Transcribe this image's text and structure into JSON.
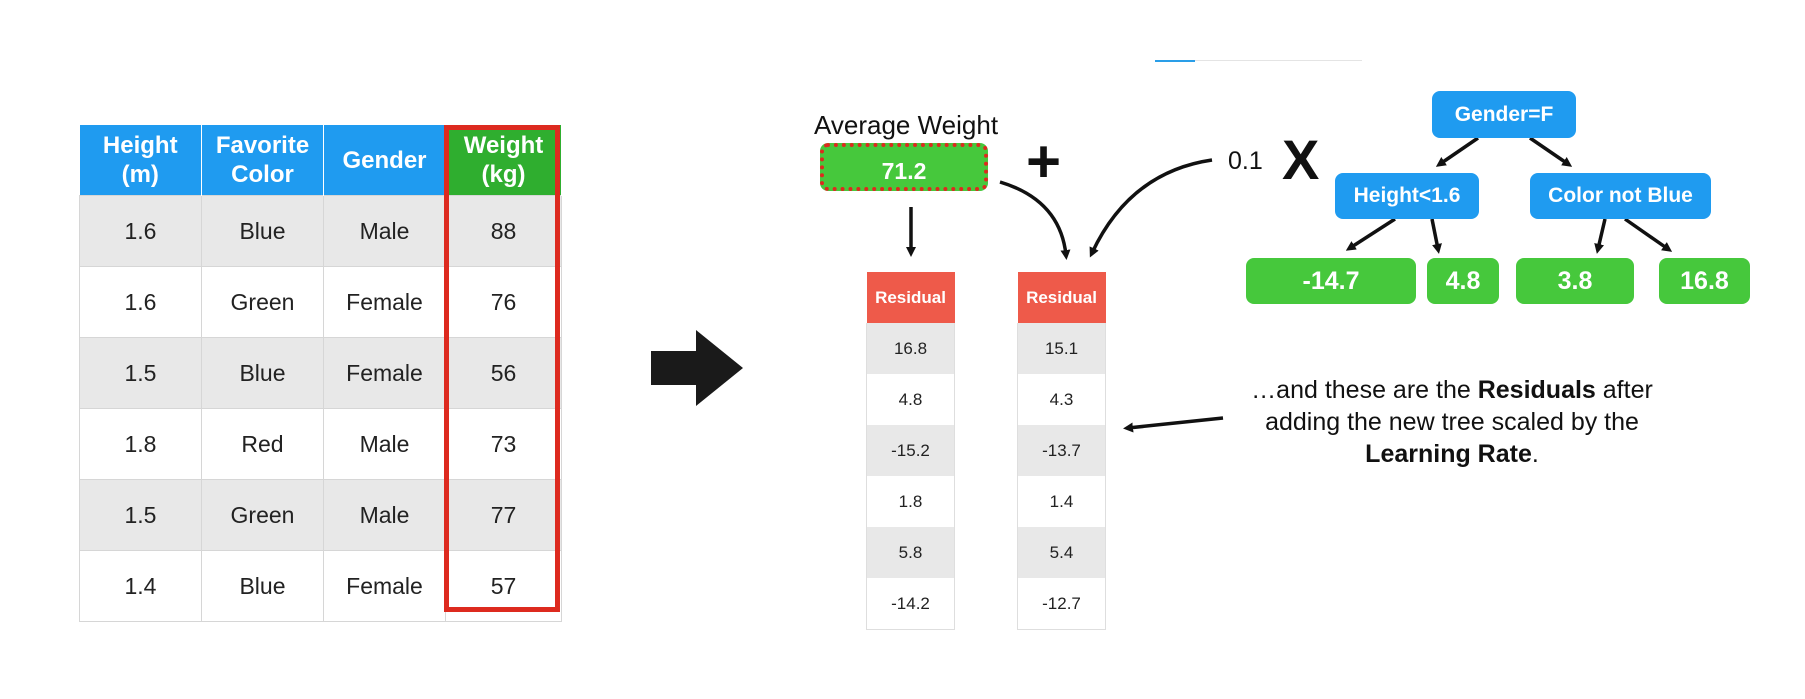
{
  "table": {
    "headers": [
      "Height\n(m)",
      "Favorite\nColor",
      "Gender",
      "Weight\n(kg)"
    ],
    "rows": [
      [
        "1.6",
        "Blue",
        "Male",
        "88"
      ],
      [
        "1.6",
        "Green",
        "Female",
        "76"
      ],
      [
        "1.5",
        "Blue",
        "Female",
        "56"
      ],
      [
        "1.8",
        "Red",
        "Male",
        "73"
      ],
      [
        "1.5",
        "Green",
        "Male",
        "77"
      ],
      [
        "1.4",
        "Blue",
        "Female",
        "57"
      ]
    ]
  },
  "average_weight": {
    "label": "Average Weight",
    "value": "71.2"
  },
  "operators": {
    "plus": "+",
    "learning_rate": "0.1",
    "times": "X"
  },
  "residuals_old": {
    "header": "Residual",
    "values": [
      "16.8",
      "4.8",
      "-15.2",
      "1.8",
      "5.8",
      "-14.2"
    ]
  },
  "residuals_new": {
    "header": "Residual",
    "values": [
      "15.1",
      "4.3",
      "-13.7",
      "1.4",
      "5.4",
      "-12.7"
    ]
  },
  "tree": {
    "root": "Gender=F",
    "left": "Height<1.6",
    "right": "Color not Blue",
    "leaves": [
      "-14.7",
      "4.8",
      "3.8",
      "16.8"
    ]
  },
  "annotation": {
    "part1": "…and these are the ",
    "bold1": "Residuals",
    "part2": " after adding the new tree scaled by the ",
    "bold2": "Learning Rate",
    "part3": "."
  },
  "colors": {
    "header_blue": "#1f9bf0",
    "weight_green": "#2fae2f",
    "leaf_green": "#46c83c",
    "residual_red": "#ee5a4a",
    "highlight_red": "#dd2a1f"
  }
}
